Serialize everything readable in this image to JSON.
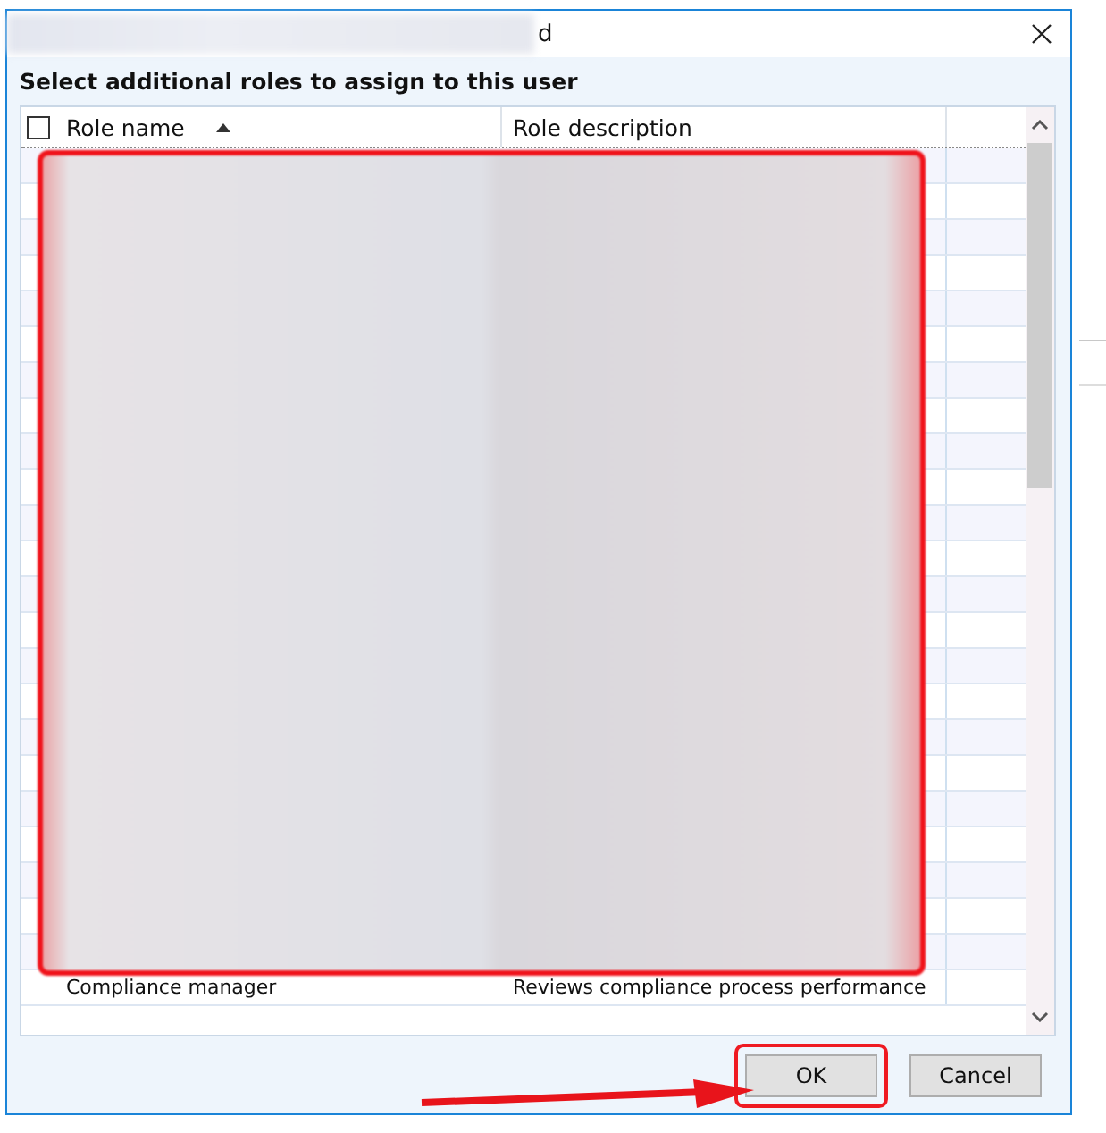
{
  "window": {
    "title": "d"
  },
  "instruction": "Select additional roles to assign to this user",
  "table": {
    "select_all": {
      "checked": false
    },
    "columns": [
      {
        "label": "Role name",
        "sorted": true
      },
      {
        "label": "Role description",
        "sorted": false
      }
    ],
    "rows": [
      {
        "kind": "redacted"
      },
      {
        "kind": "redacted"
      },
      {
        "kind": "redacted"
      },
      {
        "kind": "redacted"
      },
      {
        "kind": "redacted"
      },
      {
        "kind": "redacted"
      },
      {
        "kind": "redacted"
      },
      {
        "kind": "redacted"
      },
      {
        "kind": "redacted"
      },
      {
        "kind": "redacted"
      },
      {
        "kind": "redacted"
      },
      {
        "kind": "redacted"
      },
      {
        "kind": "redacted"
      },
      {
        "kind": "redacted"
      },
      {
        "kind": "redacted"
      },
      {
        "kind": "redacted"
      },
      {
        "kind": "redacted"
      },
      {
        "kind": "redacted"
      },
      {
        "kind": "redacted"
      },
      {
        "kind": "redacted"
      },
      {
        "kind": "redacted"
      },
      {
        "kind": "redacted"
      },
      {
        "kind": "redacted"
      },
      {
        "kind": "text",
        "name": "Compliance manager",
        "description": "Reviews compliance process performance"
      }
    ]
  },
  "buttons": [
    {
      "label": "OK",
      "highlighted": true
    },
    {
      "label": "Cancel",
      "highlighted": false
    }
  ]
}
